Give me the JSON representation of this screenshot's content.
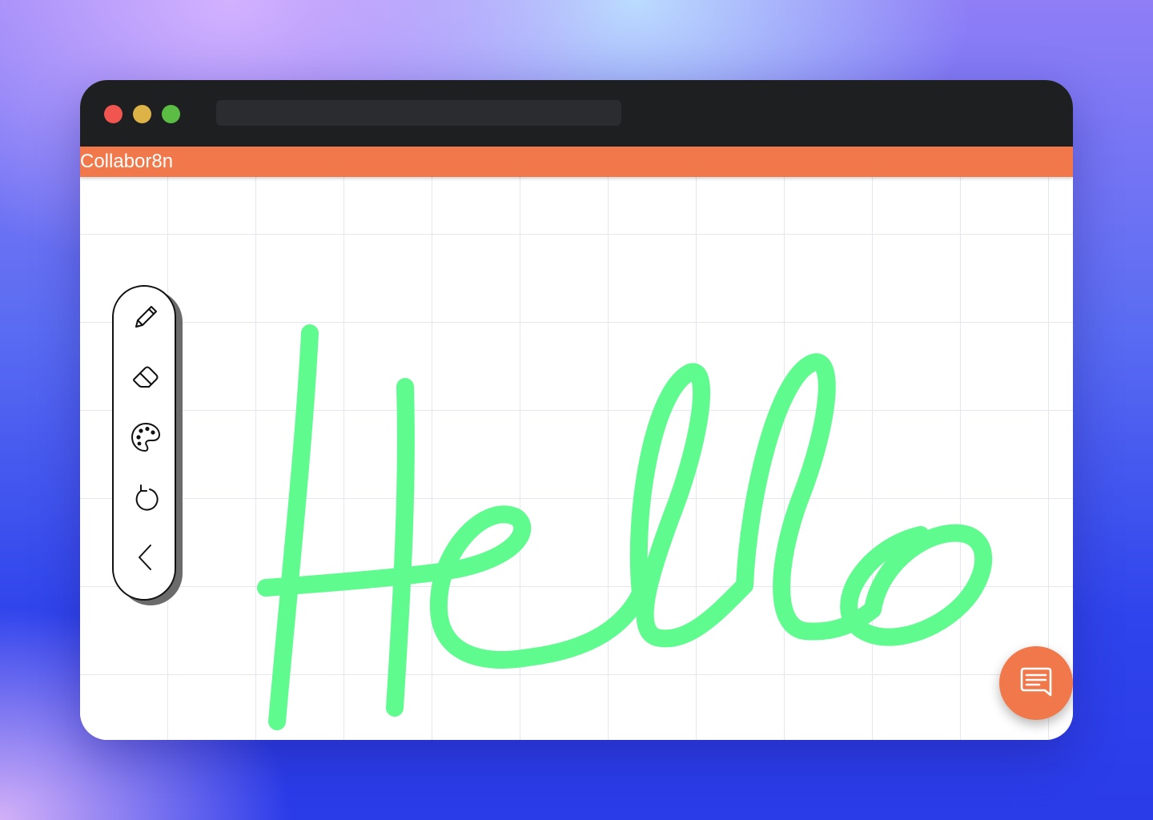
{
  "app": {
    "title": "Collabor8n",
    "accent_color": "#f0784a"
  },
  "window": {
    "traffic_lights": [
      "close",
      "minimize",
      "zoom"
    ]
  },
  "canvas": {
    "drawn_text": "Hello",
    "stroke_color": "#5ffb8e",
    "grid_color": "#e6e6f0"
  },
  "toolbar": {
    "tools": [
      {
        "name": "pencil",
        "icon": "pencil-icon"
      },
      {
        "name": "eraser",
        "icon": "eraser-icon"
      },
      {
        "name": "color-palette",
        "icon": "palette-icon"
      },
      {
        "name": "undo",
        "icon": "undo-icon"
      },
      {
        "name": "back",
        "icon": "chevron-left-icon"
      }
    ]
  },
  "chat_button": {
    "icon": "chat-icon"
  }
}
